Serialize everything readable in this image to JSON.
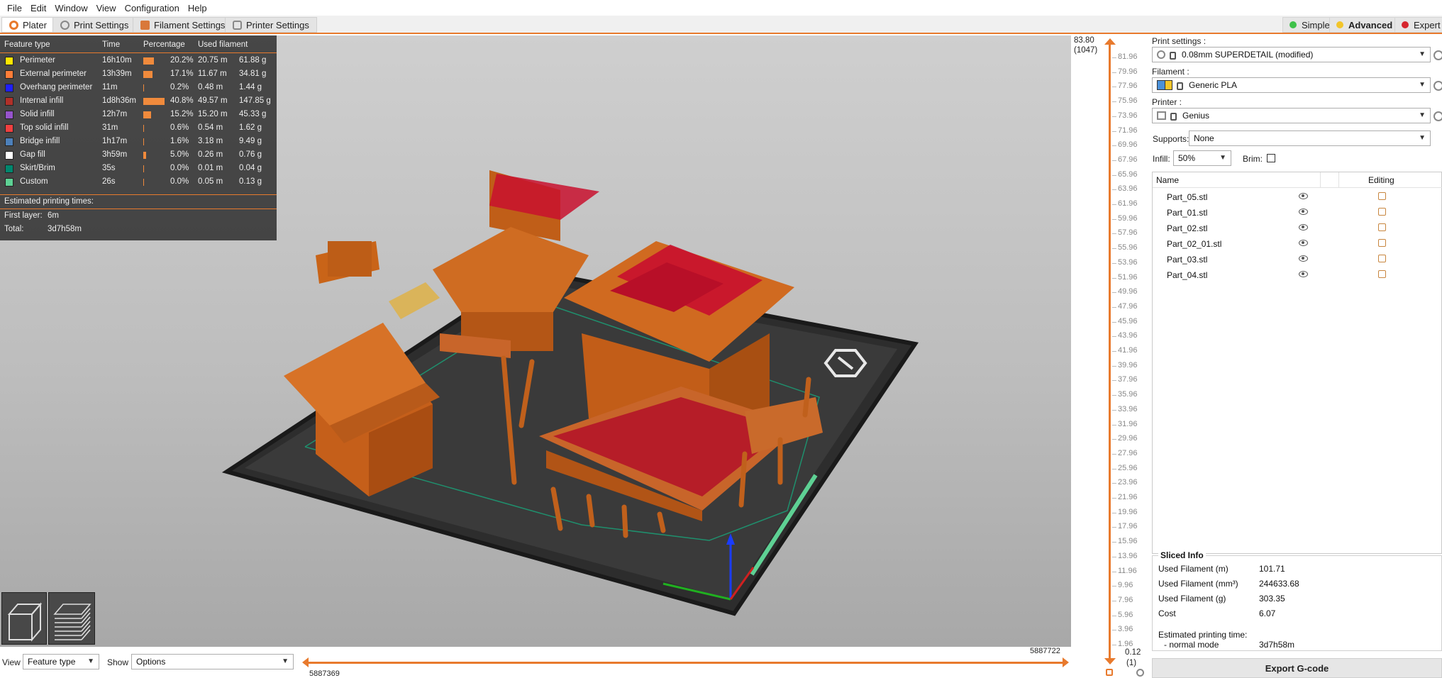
{
  "menu": [
    "File",
    "Edit",
    "Window",
    "View",
    "Configuration",
    "Help"
  ],
  "tabs": [
    {
      "label": "Plater",
      "active": true
    },
    {
      "label": "Print Settings"
    },
    {
      "label": "Filament Settings"
    },
    {
      "label": "Printer Settings"
    }
  ],
  "modes": [
    {
      "label": "Simple",
      "color": "#3fc24a"
    },
    {
      "label": "Advanced",
      "color": "#f2c52a",
      "active": true
    },
    {
      "label": "Expert",
      "color": "#d6262f"
    }
  ],
  "legend": {
    "headers": {
      "feature": "Feature type",
      "time": "Time",
      "percentage": "Percentage",
      "used": "Used filament"
    },
    "rows": [
      {
        "name": "Perimeter",
        "color": "#ffe600",
        "time": "16h10m",
        "pct": 20.2,
        "pct_text": "20.2%",
        "m": "20.75 m",
        "g": "61.88 g"
      },
      {
        "name": "External perimeter",
        "color": "#ff7d38",
        "time": "13h39m",
        "pct": 17.1,
        "pct_text": "17.1%",
        "m": "11.67 m",
        "g": "34.81 g"
      },
      {
        "name": "Overhang perimeter",
        "color": "#1f1fff",
        "time": "11m",
        "pct": 0.2,
        "pct_text": "0.2%",
        "m": "0.48 m",
        "g": "1.44 g"
      },
      {
        "name": "Internal infill",
        "color": "#b03029",
        "time": "1d8h36m",
        "pct": 40.8,
        "pct_text": "40.8%",
        "m": "49.57 m",
        "g": "147.85 g"
      },
      {
        "name": "Solid infill",
        "color": "#9654cc",
        "time": "12h7m",
        "pct": 15.2,
        "pct_text": "15.2%",
        "m": "15.20 m",
        "g": "45.33 g"
      },
      {
        "name": "Top solid infill",
        "color": "#f04040",
        "time": "31m",
        "pct": 0.6,
        "pct_text": "0.6%",
        "m": "0.54 m",
        "g": "1.62 g"
      },
      {
        "name": "Bridge infill",
        "color": "#4d80ba",
        "time": "1h17m",
        "pct": 1.6,
        "pct_text": "1.6%",
        "m": "3.18 m",
        "g": "9.49 g"
      },
      {
        "name": "Gap fill",
        "color": "#ffffff",
        "time": "3h59m",
        "pct": 5.0,
        "pct_text": "5.0%",
        "m": "0.26 m",
        "g": "0.76 g"
      },
      {
        "name": "Skirt/Brim",
        "color": "#00876e",
        "time": "35s",
        "pct": 0.0,
        "pct_text": "0.0%",
        "m": "0.01 m",
        "g": "0.04 g"
      },
      {
        "name": "Custom",
        "color": "#5ed194",
        "time": "26s",
        "pct": 0.0,
        "pct_text": "0.0%",
        "m": "0.05 m",
        "g": "0.13 g"
      }
    ],
    "estimated_label": "Estimated printing times:",
    "first_layer_label": "First layer:",
    "first_layer_value": "6m",
    "total_label": "Total:",
    "total_value": "3d7h58m"
  },
  "layer_slider": {
    "top_value": "83.80",
    "top_layer": "(1047)",
    "bottom_value": "0.12",
    "bottom_layer": "(1)",
    "ticks": [
      "81.96",
      "79.96",
      "77.96",
      "75.96",
      "73.96",
      "71.96",
      "69.96",
      "67.96",
      "65.96",
      "63.96",
      "61.96",
      "59.96",
      "57.96",
      "55.96",
      "53.96",
      "51.96",
      "49.96",
      "47.96",
      "45.96",
      "43.96",
      "41.96",
      "39.96",
      "37.96",
      "35.96",
      "33.96",
      "31.96",
      "29.96",
      "27.96",
      "25.96",
      "23.96",
      "21.96",
      "19.96",
      "17.96",
      "15.96",
      "13.96",
      "11.96",
      "9.96",
      "7.96",
      "5.96",
      "3.96",
      "1.96"
    ]
  },
  "horizontal_slider": {
    "left_value": "5887369",
    "right_value": "5887722"
  },
  "bottom": {
    "view_label": "View",
    "view_value": "Feature type",
    "show_label": "Show",
    "show_value": "Options"
  },
  "right": {
    "print_settings_label": "Print settings :",
    "print_settings_value": "0.08mm SUPERDETAIL (modified)",
    "filament_label": "Filament :",
    "filament_value": "Generic PLA",
    "filament_color": "#4a90d9",
    "printer_label": "Printer :",
    "printer_value": "Genius",
    "supports_label": "Supports:",
    "supports_value": "None",
    "infill_label": "Infill:",
    "infill_value": "50%",
    "brim_label": "Brim:",
    "brim_checked": false,
    "list_headers": {
      "name": "Name",
      "editing": "Editing"
    },
    "objects": [
      "Part_05.stl",
      "Part_01.stl",
      "Part_02.stl",
      "Part_02_01.stl",
      "Part_03.stl",
      "Part_04.stl"
    ]
  },
  "sliced_info": {
    "title": "Sliced Info",
    "rows": [
      {
        "k": "Used Filament (m)",
        "v": "101.71"
      },
      {
        "k": "Used Filament (mm³)",
        "v": "244633.68"
      },
      {
        "k": "Used Filament (g)",
        "v": "303.35"
      },
      {
        "k": "Cost",
        "v": "6.07"
      }
    ],
    "est_label": "Estimated printing time:",
    "mode_label": "- normal mode",
    "mode_value": "3d7h58m"
  },
  "export_label": "Export G-code"
}
